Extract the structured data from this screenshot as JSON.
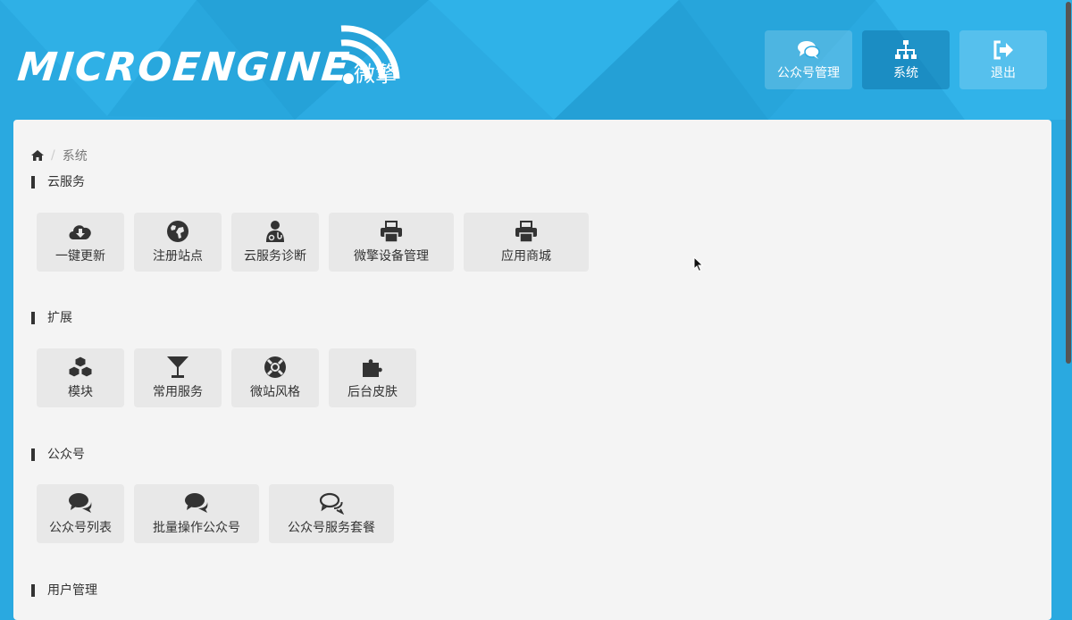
{
  "header": {
    "logo_text": "MICROENGINE",
    "logo_cn": "微擎",
    "nav": [
      {
        "label": "公众号管理",
        "icon": "chat-bubbles-icon",
        "active": false
      },
      {
        "label": "系统",
        "icon": "sitemap-icon",
        "active": true
      },
      {
        "label": "退出",
        "icon": "sign-out-icon",
        "active": false
      }
    ]
  },
  "breadcrumb": {
    "current": "系统"
  },
  "sections": [
    {
      "title": "云服务",
      "items": [
        {
          "label": "一键更新",
          "icon": "cloud-download-icon"
        },
        {
          "label": "注册站点",
          "icon": "globe-icon"
        },
        {
          "label": "云服务诊断",
          "icon": "user-md-icon"
        },
        {
          "label": "微擎设备管理",
          "icon": "print-icon"
        },
        {
          "label": "应用商城",
          "icon": "print-icon"
        }
      ]
    },
    {
      "title": "扩展",
      "items": [
        {
          "label": "模块",
          "icon": "cubes-icon"
        },
        {
          "label": "常用服务",
          "icon": "glass-icon"
        },
        {
          "label": "微站风格",
          "icon": "life-ring-icon"
        },
        {
          "label": "后台皮肤",
          "icon": "puzzle-piece-icon"
        }
      ]
    },
    {
      "title": "公众号",
      "items": [
        {
          "label": "公众号列表",
          "icon": "comments-icon"
        },
        {
          "label": "批量操作公众号",
          "icon": "comments-icon"
        },
        {
          "label": "公众号服务套餐",
          "icon": "comments-outline-icon"
        }
      ]
    },
    {
      "title": "用户管理",
      "items": []
    }
  ],
  "colors": {
    "header_bg": "#2aa9e0",
    "panel_bg": "#f4f4f4",
    "tile_bg": "#e8e8e8",
    "text": "#333333"
  }
}
